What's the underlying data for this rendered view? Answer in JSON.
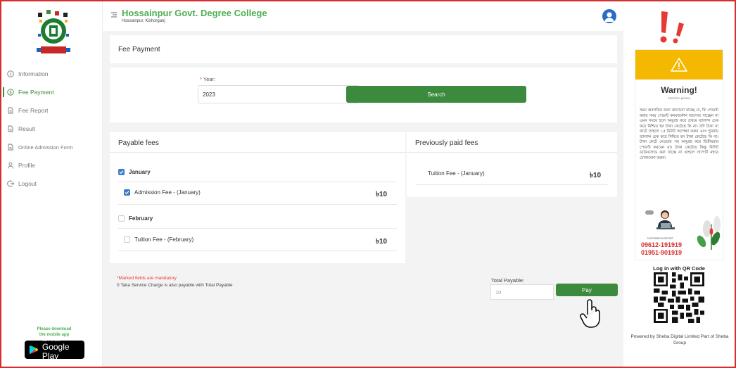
{
  "sidebar": {
    "items": [
      {
        "label": "Information",
        "icon": "info-icon"
      },
      {
        "label": "Fee Payment",
        "icon": "dollar-icon",
        "active": true
      },
      {
        "label": "Fee Report",
        "icon": "document-icon"
      },
      {
        "label": "Result",
        "icon": "document-icon"
      },
      {
        "label": "Online Admission Form",
        "icon": "document-icon"
      },
      {
        "label": "Profile",
        "icon": "user-icon"
      },
      {
        "label": "Logout",
        "icon": "logout-icon"
      }
    ],
    "download_text_line1": "Please download",
    "download_text_line2": "the mobile app",
    "gplay_small": "GET IT ON",
    "gplay_big": "Google Play"
  },
  "header": {
    "title": "Hossainpur Govt. Degree College",
    "subtitle": "Hossainpur, Kishorganj"
  },
  "page_title": "Fee Payment",
  "form": {
    "year_required_mark": "*",
    "year_label": "Year:",
    "year_value": "2023",
    "search_label": "Search"
  },
  "payable": {
    "title": "Payable fees",
    "months": [
      {
        "name": "January",
        "checked": true,
        "fees": [
          {
            "label": "Admission Fee - (January)",
            "amount": "৳10",
            "checked": true
          }
        ]
      },
      {
        "name": "February",
        "checked": false,
        "fees": [
          {
            "label": "Tuition Fee - (February)",
            "amount": "৳10",
            "checked": false
          }
        ]
      }
    ]
  },
  "paid": {
    "title": "Previously paid fees",
    "items": [
      {
        "label": "Tuition Fee - (January)",
        "amount": "৳10"
      }
    ]
  },
  "footer_notes": {
    "mandatory": "*Marked fields are mandatory",
    "service_charge": "0 Taka Service Charge is also payable with Total Payable"
  },
  "total": {
    "label": "Total Payable:",
    "value": "10",
    "pay_label": "Pay"
  },
  "ad": {
    "warning_title": "Warning!",
    "warning_sub": "Attention please",
    "warning_body": "সময় অবগতির জন্য জানানো যাচ্ছে যে, ফি পেমেন্ট করার সময় পেমেন্ট কনফার্মেশন ম্যাসেজ পাচ্ছেন না এমন সময়ে হলে অনুগ্রহ করে প্রথমে ব্যালান্স চেক করে নিশ্চিত হন টাকা কেটেছে কি না। যদি টাকা না কাটে তাহলে ১৫ মিনিট অপেক্ষা করুন এবং পুনরায় ব্যালান্স চেক করে নিশ্চিত হন টাকা কেটেছে কি না। টাকা কেটে নেওয়ার পর অনুগ্রহ করে দ্বিতীয়বার পেমেন্ট করবেন না। টাকা কেটেছে কিন্তু রিসিট ডাউনলোড করা যাচ্ছে না তাহলে সাপোর্ট নম্বরে যোগাযোগ করুন।",
    "cs_label": "CUSTOMER SUPPORT",
    "phone1": "09612-191919",
    "phone2": "01951-901919",
    "qr_title": "Log in with QR Code",
    "powered": "Powered by Sheba Digital Limited Part of Sheba Group"
  },
  "colors": {
    "accent": "#3b8a3e",
    "title_green": "#4caf50",
    "warning_yellow": "#f5b800",
    "border_red": "#d32f2f",
    "check_blue": "#3d7dca"
  }
}
